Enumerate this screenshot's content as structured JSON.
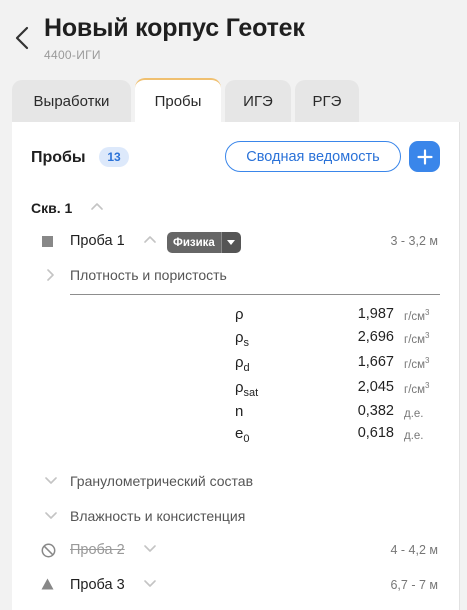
{
  "header": {
    "title": "Новый корпус Геотек",
    "subtitle": "4400-ИГИ"
  },
  "tabs": [
    {
      "label": "Выработки",
      "active": false
    },
    {
      "label": "Пробы",
      "active": true
    },
    {
      "label": "ИГЭ",
      "active": false
    },
    {
      "label": "РГЭ",
      "active": false
    }
  ],
  "section": {
    "title": "Пробы",
    "count": "13",
    "summary_button": "Сводная ведомость"
  },
  "well": {
    "label": "Скв. 1"
  },
  "samples": [
    {
      "name": "Проба 1",
      "badge": "Физика",
      "range": "3 - 3,2 м",
      "marker": "square-icon",
      "crossed": false
    },
    {
      "name": "Проба 2",
      "range": "4 - 4,2 м",
      "marker": "prohibited-icon",
      "crossed": true
    },
    {
      "name": "Проба 3",
      "range": "6,7 - 7 м",
      "marker": "triangle-icon",
      "crossed": false
    }
  ],
  "groups": {
    "density": "Плотность и пористость",
    "granulometry": "Гранулометрический состав",
    "moisture": "Влажность и консистенция"
  },
  "properties": [
    {
      "symbol": "ρ",
      "sub": "",
      "value": "1,987",
      "unit": "г/см",
      "unit_sup": "3"
    },
    {
      "symbol": "ρ",
      "sub": "s",
      "value": "2,696",
      "unit": "г/см",
      "unit_sup": "3"
    },
    {
      "symbol": "ρ",
      "sub": "d",
      "value": "1,667",
      "unit": "г/см",
      "unit_sup": "3"
    },
    {
      "symbol": "ρ",
      "sub": "sat",
      "value": "2,045",
      "unit": "г/см",
      "unit_sup": "3"
    },
    {
      "symbol": "n",
      "sub": "",
      "value": "0,382",
      "unit": "д.е.",
      "unit_sup": ""
    },
    {
      "symbol": "e",
      "sub": "0",
      "value": "0,618",
      "unit": "д.е.",
      "unit_sup": ""
    }
  ],
  "colors": {
    "accent": "#3a86ea",
    "badge_bg": "#dde9fb",
    "tag_bg": "#666666",
    "tab_active_border": "#f0c070"
  }
}
